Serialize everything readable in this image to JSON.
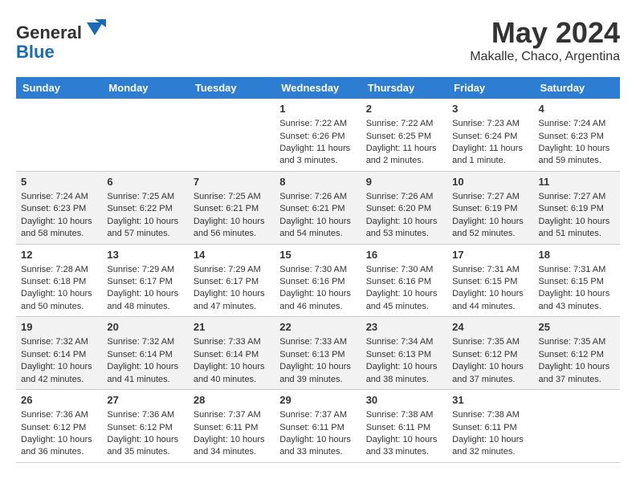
{
  "header": {
    "logo_line1": "General",
    "logo_line2": "Blue",
    "main_title": "May 2024",
    "subtitle": "Makalle, Chaco, Argentina"
  },
  "days_of_week": [
    "Sunday",
    "Monday",
    "Tuesday",
    "Wednesday",
    "Thursday",
    "Friday",
    "Saturday"
  ],
  "weeks": [
    [
      {
        "day": "",
        "info": ""
      },
      {
        "day": "",
        "info": ""
      },
      {
        "day": "",
        "info": ""
      },
      {
        "day": "1",
        "info": "Sunrise: 7:22 AM\nSunset: 6:26 PM\nDaylight: 11 hours and 3 minutes."
      },
      {
        "day": "2",
        "info": "Sunrise: 7:22 AM\nSunset: 6:25 PM\nDaylight: 11 hours and 2 minutes."
      },
      {
        "day": "3",
        "info": "Sunrise: 7:23 AM\nSunset: 6:24 PM\nDaylight: 11 hours and 1 minute."
      },
      {
        "day": "4",
        "info": "Sunrise: 7:24 AM\nSunset: 6:23 PM\nDaylight: 10 hours and 59 minutes."
      }
    ],
    [
      {
        "day": "5",
        "info": "Sunrise: 7:24 AM\nSunset: 6:23 PM\nDaylight: 10 hours and 58 minutes."
      },
      {
        "day": "6",
        "info": "Sunrise: 7:25 AM\nSunset: 6:22 PM\nDaylight: 10 hours and 57 minutes."
      },
      {
        "day": "7",
        "info": "Sunrise: 7:25 AM\nSunset: 6:21 PM\nDaylight: 10 hours and 56 minutes."
      },
      {
        "day": "8",
        "info": "Sunrise: 7:26 AM\nSunset: 6:21 PM\nDaylight: 10 hours and 54 minutes."
      },
      {
        "day": "9",
        "info": "Sunrise: 7:26 AM\nSunset: 6:20 PM\nDaylight: 10 hours and 53 minutes."
      },
      {
        "day": "10",
        "info": "Sunrise: 7:27 AM\nSunset: 6:19 PM\nDaylight: 10 hours and 52 minutes."
      },
      {
        "day": "11",
        "info": "Sunrise: 7:27 AM\nSunset: 6:19 PM\nDaylight: 10 hours and 51 minutes."
      }
    ],
    [
      {
        "day": "12",
        "info": "Sunrise: 7:28 AM\nSunset: 6:18 PM\nDaylight: 10 hours and 50 minutes."
      },
      {
        "day": "13",
        "info": "Sunrise: 7:29 AM\nSunset: 6:17 PM\nDaylight: 10 hours and 48 minutes."
      },
      {
        "day": "14",
        "info": "Sunrise: 7:29 AM\nSunset: 6:17 PM\nDaylight: 10 hours and 47 minutes."
      },
      {
        "day": "15",
        "info": "Sunrise: 7:30 AM\nSunset: 6:16 PM\nDaylight: 10 hours and 46 minutes."
      },
      {
        "day": "16",
        "info": "Sunrise: 7:30 AM\nSunset: 6:16 PM\nDaylight: 10 hours and 45 minutes."
      },
      {
        "day": "17",
        "info": "Sunrise: 7:31 AM\nSunset: 6:15 PM\nDaylight: 10 hours and 44 minutes."
      },
      {
        "day": "18",
        "info": "Sunrise: 7:31 AM\nSunset: 6:15 PM\nDaylight: 10 hours and 43 minutes."
      }
    ],
    [
      {
        "day": "19",
        "info": "Sunrise: 7:32 AM\nSunset: 6:14 PM\nDaylight: 10 hours and 42 minutes."
      },
      {
        "day": "20",
        "info": "Sunrise: 7:32 AM\nSunset: 6:14 PM\nDaylight: 10 hours and 41 minutes."
      },
      {
        "day": "21",
        "info": "Sunrise: 7:33 AM\nSunset: 6:14 PM\nDaylight: 10 hours and 40 minutes."
      },
      {
        "day": "22",
        "info": "Sunrise: 7:33 AM\nSunset: 6:13 PM\nDaylight: 10 hours and 39 minutes."
      },
      {
        "day": "23",
        "info": "Sunrise: 7:34 AM\nSunset: 6:13 PM\nDaylight: 10 hours and 38 minutes."
      },
      {
        "day": "24",
        "info": "Sunrise: 7:35 AM\nSunset: 6:12 PM\nDaylight: 10 hours and 37 minutes."
      },
      {
        "day": "25",
        "info": "Sunrise: 7:35 AM\nSunset: 6:12 PM\nDaylight: 10 hours and 37 minutes."
      }
    ],
    [
      {
        "day": "26",
        "info": "Sunrise: 7:36 AM\nSunset: 6:12 PM\nDaylight: 10 hours and 36 minutes."
      },
      {
        "day": "27",
        "info": "Sunrise: 7:36 AM\nSunset: 6:12 PM\nDaylight: 10 hours and 35 minutes."
      },
      {
        "day": "28",
        "info": "Sunrise: 7:37 AM\nSunset: 6:11 PM\nDaylight: 10 hours and 34 minutes."
      },
      {
        "day": "29",
        "info": "Sunrise: 7:37 AM\nSunset: 6:11 PM\nDaylight: 10 hours and 33 minutes."
      },
      {
        "day": "30",
        "info": "Sunrise: 7:38 AM\nSunset: 6:11 PM\nDaylight: 10 hours and 33 minutes."
      },
      {
        "day": "31",
        "info": "Sunrise: 7:38 AM\nSunset: 6:11 PM\nDaylight: 10 hours and 32 minutes."
      },
      {
        "day": "",
        "info": ""
      }
    ]
  ]
}
